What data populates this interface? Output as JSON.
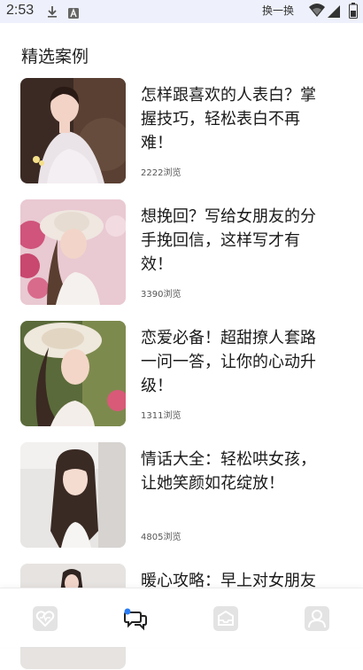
{
  "status_bar": {
    "time": "2:53",
    "swap_label": "换一换",
    "icons": [
      "download-icon",
      "a-icon",
      "wifi-icon",
      "signal-icon",
      "battery-icon"
    ]
  },
  "section": {
    "title": "精选案例"
  },
  "cases": [
    {
      "title": "怎样跟喜欢的人表白？掌握技巧，轻松表白不再难！",
      "views": "2222浏览",
      "image": "girl-in-white-dress-photo"
    },
    {
      "title": "想挽回？写给女朋友的分手挽回信，这样写才有效！",
      "views": "3390浏览",
      "image": "girl-with-sunhat-flowers-photo"
    },
    {
      "title": "恋爱必备！超甜撩人套路一问一答，让你的心动升级！",
      "views": "1311浏览",
      "image": "girl-with-straw-hat-photo"
    },
    {
      "title": "情话大全：轻松哄女孩，让她笑颜如花绽放！",
      "views": "4805浏览",
      "image": "girl-long-hair-photo"
    },
    {
      "title": "暖心攻略：早上对女朋友",
      "views": "",
      "image": "girl-partial-photo"
    }
  ],
  "bottom_nav": {
    "items": [
      "heart-icon",
      "chat-icon",
      "inbox-icon",
      "profile-icon"
    ],
    "active": "chat-icon",
    "active_color": "#2a7cf5"
  }
}
